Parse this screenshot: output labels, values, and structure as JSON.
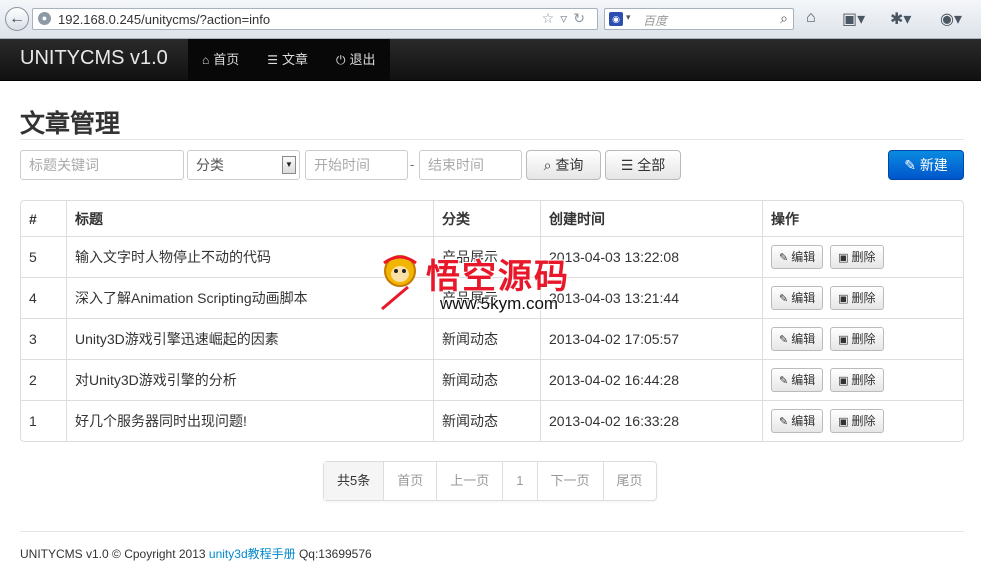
{
  "browser": {
    "url": "192.168.0.245/unitycms/?action=info",
    "search_placeholder": "百度"
  },
  "navbar": {
    "brand": "UNITYCMS v1.0",
    "items": [
      {
        "label": "首页",
        "icon": "home-icon"
      },
      {
        "label": "文章",
        "icon": "list-icon"
      },
      {
        "label": "退出",
        "icon": "power-icon"
      }
    ]
  },
  "page": {
    "title": "文章管理"
  },
  "filters": {
    "keyword_placeholder": "标题关键词",
    "category_value": "分类",
    "start_placeholder": "开始时间",
    "separator": "-",
    "end_placeholder": "结束时间",
    "query_label": "查询",
    "all_label": "全部",
    "new_label": "新建"
  },
  "table": {
    "headers": [
      "#",
      "标题",
      "分类",
      "创建时间",
      "操作"
    ],
    "rows": [
      {
        "id": "5",
        "title": "输入文字时人物停止不动的代码",
        "category": "产品展示",
        "created": "2013-04-03 13:22:08"
      },
      {
        "id": "4",
        "title": "深入了解Animation Scripting动画脚本",
        "category": "产品展示",
        "created": "2013-04-03 13:21:44"
      },
      {
        "id": "3",
        "title": "Unity3D游戏引擎迅速崛起的因素",
        "category": "新闻动态",
        "created": "2013-04-02 17:05:57"
      },
      {
        "id": "2",
        "title": "对Unity3D游戏引擎的分析",
        "category": "新闻动态",
        "created": "2013-04-02 16:44:28"
      },
      {
        "id": "1",
        "title": "好几个服务器同时出现问题!",
        "category": "新闻动态",
        "created": "2013-04-02 16:33:28"
      }
    ],
    "edit_label": "编辑",
    "delete_label": "删除"
  },
  "pagination": {
    "total": "共5条",
    "first": "首页",
    "prev": "上一页",
    "current": "1",
    "next": "下一页",
    "last": "尾页"
  },
  "footer": {
    "copyright": "UNITYCMS v1.0 © Cpoyright 2013",
    "link_text": "unity3d教程手册",
    "qq": "Qq:13699576"
  },
  "watermark": {
    "title": "悟空源码",
    "url": "www.5kym.com"
  },
  "colors": {
    "navbar_bg": "#111111",
    "primary": "#0066cc",
    "link": "#0088cc",
    "watermark_red": "#e8182a"
  }
}
